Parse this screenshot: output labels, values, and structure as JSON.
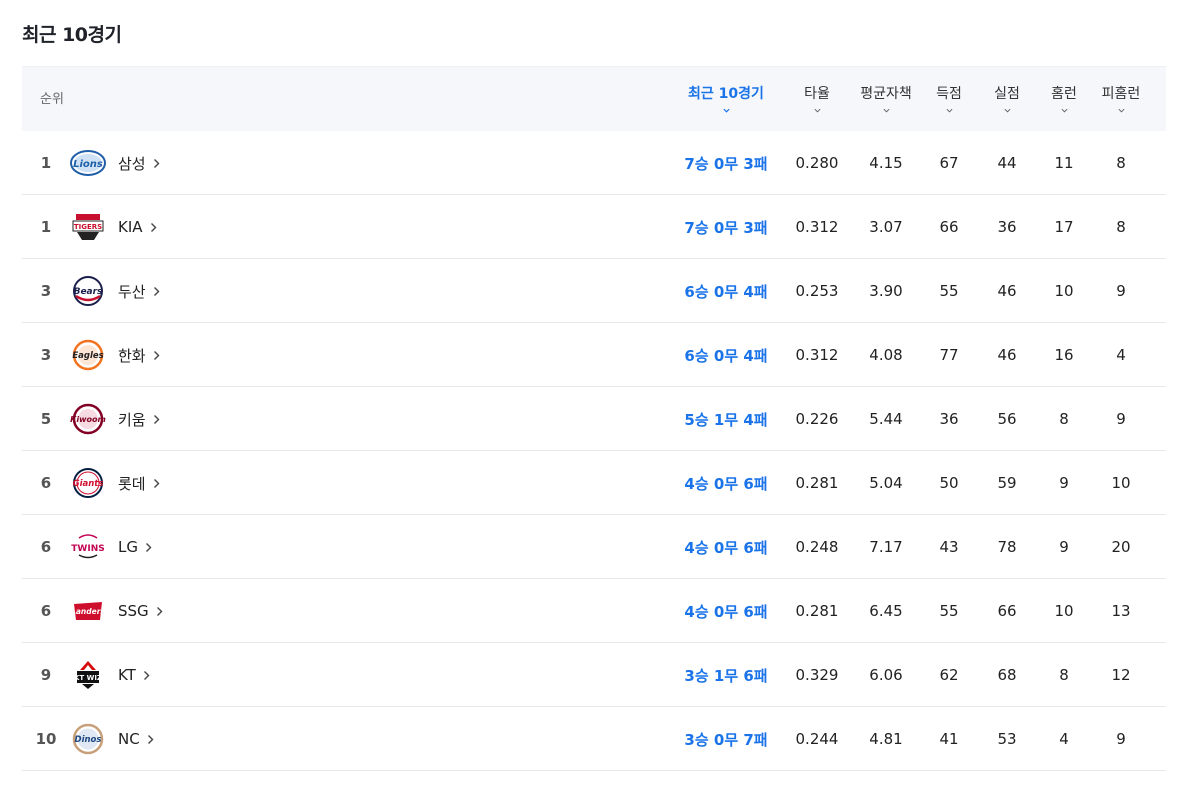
{
  "title": "최근 10경기",
  "header": {
    "rank": "순위",
    "recent10": "최근 10경기",
    "avg": "타율",
    "era": "평균자책",
    "runs": "득점",
    "runs_allowed": "실점",
    "hr": "홈런",
    "hr_allowed": "피홈런"
  },
  "colors": {
    "accent": "#1a73e8",
    "header_bg": "#f5f7fa",
    "divider": "#e6e8eb"
  },
  "rows": [
    {
      "rank": "1",
      "team": "삼성",
      "logo": "lions-logo",
      "record": "7승 0무 3패",
      "avg": "0.280",
      "era": "4.15",
      "runs": "67",
      "runs_allowed": "44",
      "hr": "11",
      "hr_allowed": "8"
    },
    {
      "rank": "1",
      "team": "KIA",
      "logo": "tigers-logo",
      "record": "7승 0무 3패",
      "avg": "0.312",
      "era": "3.07",
      "runs": "66",
      "runs_allowed": "36",
      "hr": "17",
      "hr_allowed": "8"
    },
    {
      "rank": "3",
      "team": "두산",
      "logo": "bears-logo",
      "record": "6승 0무 4패",
      "avg": "0.253",
      "era": "3.90",
      "runs": "55",
      "runs_allowed": "46",
      "hr": "10",
      "hr_allowed": "9"
    },
    {
      "rank": "3",
      "team": "한화",
      "logo": "eagles-logo",
      "record": "6승 0무 4패",
      "avg": "0.312",
      "era": "4.08",
      "runs": "77",
      "runs_allowed": "46",
      "hr": "16",
      "hr_allowed": "4"
    },
    {
      "rank": "5",
      "team": "키움",
      "logo": "heroes-logo",
      "record": "5승 1무 4패",
      "avg": "0.226",
      "era": "5.44",
      "runs": "36",
      "runs_allowed": "56",
      "hr": "8",
      "hr_allowed": "9"
    },
    {
      "rank": "6",
      "team": "롯데",
      "logo": "giants-logo",
      "record": "4승 0무 6패",
      "avg": "0.281",
      "era": "5.04",
      "runs": "50",
      "runs_allowed": "59",
      "hr": "9",
      "hr_allowed": "10"
    },
    {
      "rank": "6",
      "team": "LG",
      "logo": "twins-logo",
      "record": "4승 0무 6패",
      "avg": "0.248",
      "era": "7.17",
      "runs": "43",
      "runs_allowed": "78",
      "hr": "9",
      "hr_allowed": "20"
    },
    {
      "rank": "6",
      "team": "SSG",
      "logo": "landers-logo",
      "record": "4승 0무 6패",
      "avg": "0.281",
      "era": "6.45",
      "runs": "55",
      "runs_allowed": "66",
      "hr": "10",
      "hr_allowed": "13"
    },
    {
      "rank": "9",
      "team": "KT",
      "logo": "wiz-logo",
      "record": "3승 1무 6패",
      "avg": "0.329",
      "era": "6.06",
      "runs": "62",
      "runs_allowed": "68",
      "hr": "8",
      "hr_allowed": "12"
    },
    {
      "rank": "10",
      "team": "NC",
      "logo": "dinos-logo",
      "record": "3승 0무 7패",
      "avg": "0.244",
      "era": "4.81",
      "runs": "41",
      "runs_allowed": "53",
      "hr": "4",
      "hr_allowed": "9"
    }
  ]
}
